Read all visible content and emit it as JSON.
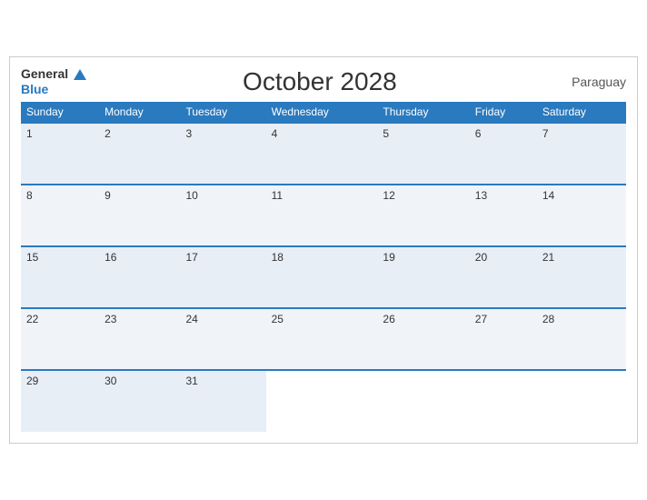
{
  "header": {
    "logo_general": "General",
    "logo_blue": "Blue",
    "title": "October 2028",
    "country": "Paraguay"
  },
  "days_of_week": [
    "Sunday",
    "Monday",
    "Tuesday",
    "Wednesday",
    "Thursday",
    "Friday",
    "Saturday"
  ],
  "weeks": [
    [
      "1",
      "2",
      "3",
      "4",
      "5",
      "6",
      "7"
    ],
    [
      "8",
      "9",
      "10",
      "11",
      "12",
      "13",
      "14"
    ],
    [
      "15",
      "16",
      "17",
      "18",
      "19",
      "20",
      "21"
    ],
    [
      "22",
      "23",
      "24",
      "25",
      "26",
      "27",
      "28"
    ],
    [
      "29",
      "30",
      "31",
      "",
      "",
      "",
      ""
    ]
  ],
  "colors": {
    "header_bg": "#2a7abf",
    "header_text": "#ffffff",
    "accent": "#2a7abf"
  }
}
